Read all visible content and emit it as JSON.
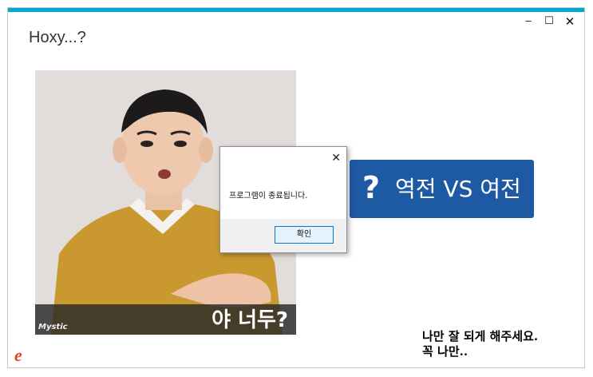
{
  "window": {
    "title": "Hoxy...?",
    "minimize_glyph": "‒",
    "maximize_glyph": "☐",
    "close_glyph": "✕"
  },
  "photo": {
    "brand": "Mystic",
    "caption": "야 너두?"
  },
  "action_button": {
    "icon": "question-icon",
    "icon_glyph": "?",
    "label": "역전 VS 여전",
    "color": "#1e5aa3"
  },
  "dialog": {
    "close_glyph": "✕",
    "message": "프로그램이 종료됩니다.",
    "ok_label": "확인"
  },
  "note": {
    "line1": "나만 잘 되게 해주세요.",
    "line2": "꼭 나만.."
  },
  "ie_icon": {
    "icon": "internet-explorer-icon",
    "glyph": "e"
  },
  "colors": {
    "accent": "#00a9cf",
    "button_blue": "#1e5aa3",
    "sweater": "#c9982f"
  }
}
